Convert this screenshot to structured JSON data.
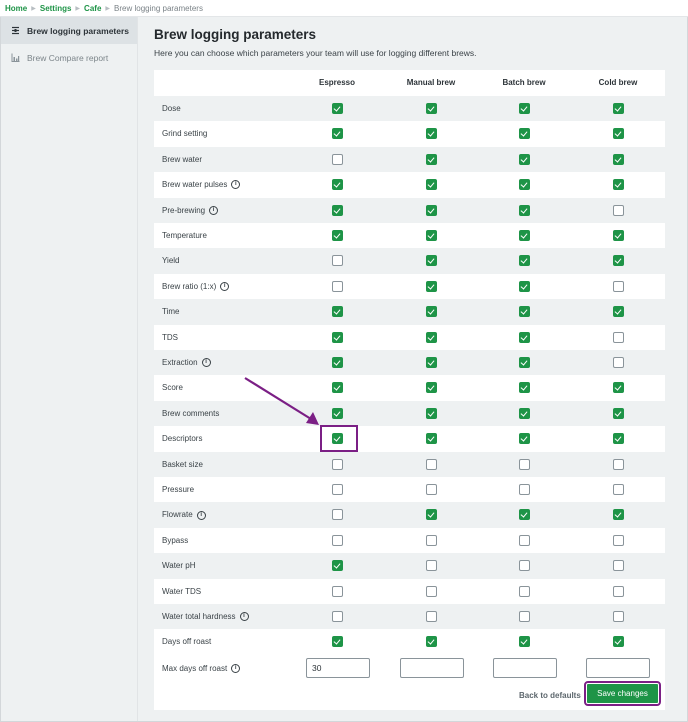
{
  "breadcrumb": {
    "items": [
      {
        "label": "Home",
        "link": true
      },
      {
        "label": "Settings",
        "link": true
      },
      {
        "label": "Cafe",
        "link": true
      },
      {
        "label": "Brew logging parameters",
        "link": false
      }
    ]
  },
  "sidebar": {
    "items": [
      {
        "label": "Brew logging parameters",
        "icon": "sliders-icon",
        "active": true
      },
      {
        "label": "Brew Compare report",
        "icon": "bar-chart-icon",
        "active": false
      }
    ]
  },
  "main": {
    "title": "Brew logging parameters",
    "description": "Here you can choose which parameters your team will use for logging different brews.",
    "columns": [
      "Espresso",
      "Manual brew",
      "Batch brew",
      "Cold brew"
    ],
    "rows": [
      {
        "label": "Dose",
        "info": false,
        "values": [
          true,
          true,
          true,
          true
        ]
      },
      {
        "label": "Grind setting",
        "info": false,
        "values": [
          true,
          true,
          true,
          true
        ]
      },
      {
        "label": "Brew water",
        "info": false,
        "values": [
          false,
          true,
          true,
          true
        ]
      },
      {
        "label": "Brew water pulses",
        "info": true,
        "values": [
          true,
          true,
          true,
          true
        ]
      },
      {
        "label": "Pre-brewing",
        "info": true,
        "values": [
          true,
          true,
          true,
          false
        ]
      },
      {
        "label": "Temperature",
        "info": false,
        "values": [
          true,
          true,
          true,
          true
        ]
      },
      {
        "label": "Yield",
        "info": false,
        "values": [
          false,
          true,
          true,
          true
        ]
      },
      {
        "label": "Brew ratio (1:x)",
        "info": true,
        "values": [
          false,
          true,
          true,
          false
        ]
      },
      {
        "label": "Time",
        "info": false,
        "values": [
          true,
          true,
          true,
          true
        ]
      },
      {
        "label": "TDS",
        "info": false,
        "values": [
          true,
          true,
          true,
          false
        ]
      },
      {
        "label": "Extraction",
        "info": true,
        "values": [
          true,
          true,
          true,
          false
        ]
      },
      {
        "label": "Score",
        "info": false,
        "values": [
          true,
          true,
          true,
          true
        ]
      },
      {
        "label": "Brew comments",
        "info": false,
        "values": [
          true,
          true,
          true,
          true
        ]
      },
      {
        "label": "Descriptors",
        "info": false,
        "values": [
          true,
          true,
          true,
          true
        ]
      },
      {
        "label": "Basket size",
        "info": false,
        "values": [
          false,
          false,
          false,
          false
        ]
      },
      {
        "label": "Pressure",
        "info": false,
        "values": [
          false,
          false,
          false,
          false
        ]
      },
      {
        "label": "Flowrate",
        "info": true,
        "values": [
          false,
          true,
          true,
          true
        ]
      },
      {
        "label": "Bypass",
        "info": false,
        "values": [
          false,
          false,
          false,
          false
        ]
      },
      {
        "label": "Water pH",
        "info": false,
        "values": [
          true,
          false,
          false,
          false
        ]
      },
      {
        "label": "Water TDS",
        "info": false,
        "values": [
          false,
          false,
          false,
          false
        ]
      },
      {
        "label": "Water total hardness",
        "info": true,
        "values": [
          false,
          false,
          false,
          false
        ]
      },
      {
        "label": "Days off roast",
        "info": false,
        "values": [
          true,
          true,
          true,
          true
        ]
      }
    ],
    "max_days": {
      "label": "Max days off roast",
      "info": true,
      "values": [
        "30",
        "",
        "",
        ""
      ]
    },
    "back_to_defaults": "Back to defaults",
    "save_changes": "Save changes"
  },
  "annotation": {
    "highlighted_cell": {
      "row": "Descriptors",
      "column": "Espresso"
    },
    "color": "#7b1f85"
  },
  "colors": {
    "accent": "#1e9447",
    "annotation": "#7b1f85"
  }
}
